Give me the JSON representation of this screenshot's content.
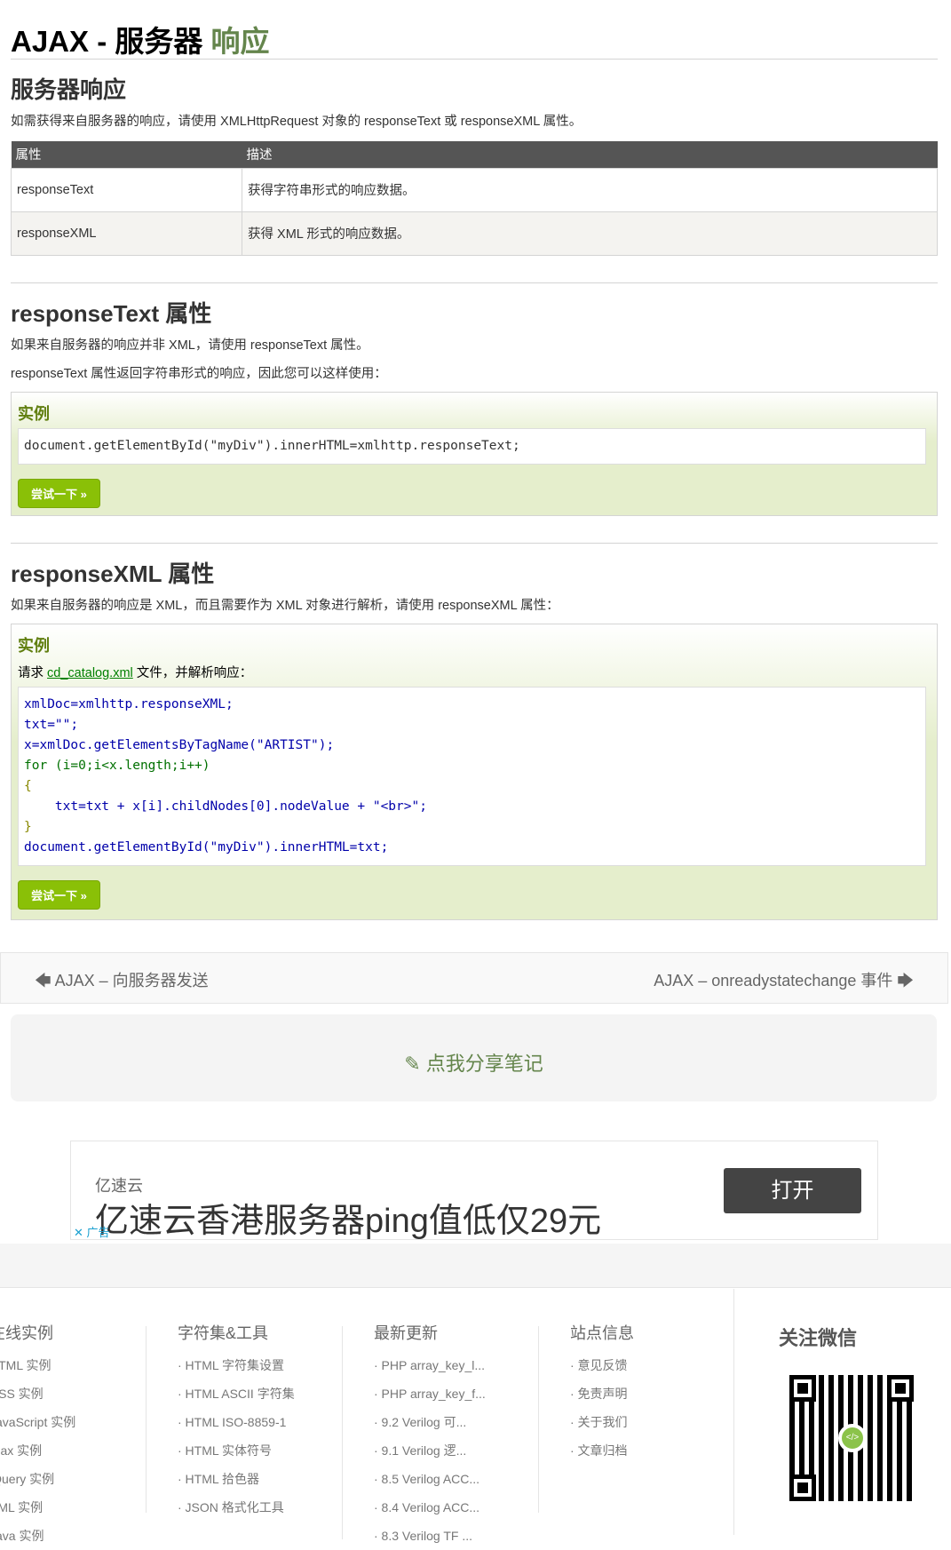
{
  "title": {
    "prefix": "AJAX - 服务器",
    "highlight": "响应"
  },
  "s1": {
    "heading": "服务器响应",
    "intro": "如需获得来自服务器的响应，请使用 XMLHttpRequest 对象的 responseText 或 responseXML 属性。",
    "table": {
      "headers": [
        "属性",
        "描述"
      ],
      "rows": [
        [
          "responseText",
          "获得字符串形式的响应数据。"
        ],
        [
          "responseXML",
          "获得 XML 形式的响应数据。"
        ]
      ]
    }
  },
  "s2": {
    "heading": "responseText 属性",
    "p1": "如果来自服务器的响应并非 XML，请使用 responseText 属性。",
    "p2": "responseText 属性返回字符串形式的响应，因此您可以这样使用：",
    "example_label": "实例",
    "code": "document.getElementById(\"myDiv\").innerHTML=xmlhttp.responseText;",
    "try": "尝试一下 »"
  },
  "s3": {
    "heading": "responseXML 属性",
    "p1": "如果来自服务器的响应是 XML，而且需要作为 XML 对象进行解析，请使用 responseXML 属性：",
    "example_label": "实例",
    "req_pre": "请求 ",
    "req_link": "cd_catalog.xml",
    "req_post": " 文件，并解析响应：",
    "code_lines": [
      "xmlDoc=xmlhttp.responseXML;",
      "txt=\"\";",
      "x=xmlDoc.getElementsByTagName(\"ARTIST\");",
      "for (i=0;i<x.length;i++)",
      "{",
      "    txt=txt + x[i].childNodes[0].nodeValue + \"<br>\";",
      "}",
      "document.getElementById(\"myDiv\").innerHTML=txt;"
    ],
    "try": "尝试一下 »"
  },
  "nav": {
    "prev": "AJAX – 向服务器发送",
    "next": "AJAX – onreadystatechange 事件"
  },
  "notes": "点我分享笔记",
  "ad": {
    "brand": "亿速云",
    "headline": "亿速云香港服务器ping值低仅29元",
    "open": "打开",
    "tag": "✕ 广告"
  },
  "footer": {
    "cols": [
      {
        "title": "在线实例",
        "items": [
          "HTML 实例",
          "CSS 实例",
          "JavaScript 实例",
          "Ajax 实例",
          "jQuery 实例",
          "XML 实例",
          "Java 实例"
        ]
      },
      {
        "title": "字符集&工具",
        "items": [
          "· HTML 字符集设置",
          "· HTML ASCII 字符集",
          "· HTML ISO-8859-1",
          "· HTML 实体符号",
          "· HTML 拾色器",
          "· JSON 格式化工具"
        ]
      },
      {
        "title": "最新更新",
        "items": [
          "· PHP array_key_l...",
          "· PHP array_key_f...",
          "· 9.2 Verilog 可...",
          "· 9.1 Verilog 逻...",
          "· 8.5 Verilog ACC...",
          "· 8.4 Verilog ACC...",
          "· 8.3 Verilog TF ..."
        ]
      },
      {
        "title": "站点信息",
        "items": [
          "· 意见反馈",
          "· 免责声明",
          "· 关于我们",
          "· 文章归档"
        ]
      }
    ],
    "wechat": "关注微信"
  }
}
